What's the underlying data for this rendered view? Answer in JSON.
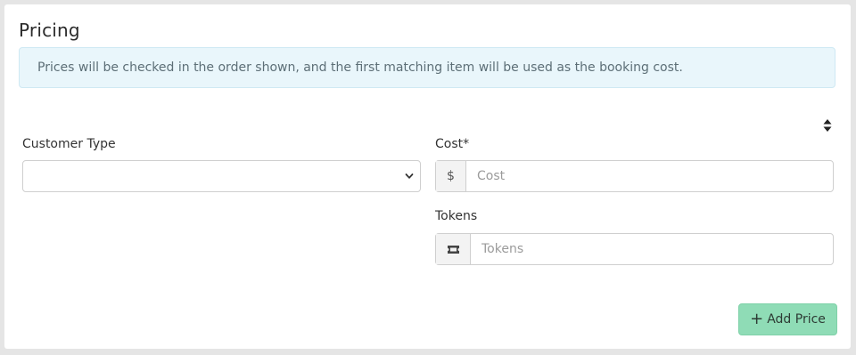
{
  "card": {
    "title": "Pricing",
    "info_text": "Prices will be checked in the order shown, and the first matching item will be used as the booking cost."
  },
  "form": {
    "customer_type": {
      "label": "Customer Type",
      "value": ""
    },
    "cost": {
      "label": "Cost*",
      "prefix": "$",
      "placeholder": "Cost",
      "value": ""
    },
    "tokens": {
      "label": "Tokens",
      "placeholder": "Tokens",
      "value": ""
    }
  },
  "actions": {
    "add_price_label": "Add Price",
    "add_icon": "plus-icon"
  },
  "colors": {
    "info_bg": "#e9f6fb",
    "add_button_bg": "#8fdcb6"
  },
  "icons": {
    "sort": "sort-icon",
    "select_chevron": "chevron-down-icon",
    "tokens_addon": "ticket-icon"
  }
}
